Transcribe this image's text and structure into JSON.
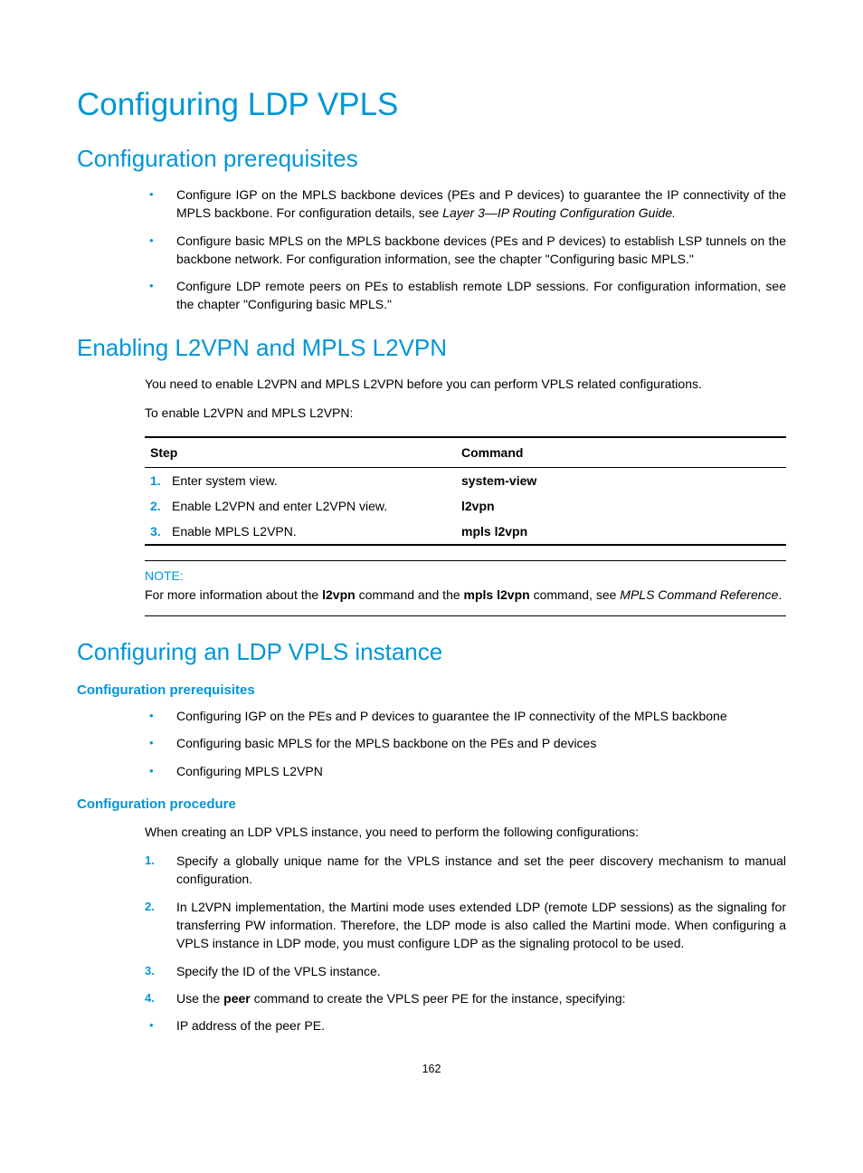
{
  "h1": "Configuring LDP VPLS",
  "sec1": {
    "title": "Configuration prerequisites",
    "bullets": [
      {
        "pre": "Configure IGP on the MPLS backbone devices (PEs and P devices) to guarantee the IP connectivity of the MPLS backbone. For configuration details, see ",
        "italic": "Layer 3—IP Routing Configuration Guide."
      },
      {
        "pre": "Configure basic MPLS on the MPLS backbone devices (PEs and P devices) to establish LSP tunnels on the backbone network. For configuration information, see the chapter \"Configuring basic MPLS.\""
      },
      {
        "pre": "Configure LDP remote peers on PEs to establish remote LDP sessions. For configuration information, see the chapter \"Configuring basic MPLS.\""
      }
    ]
  },
  "sec2": {
    "title": "Enabling L2VPN and MPLS L2VPN",
    "p1": "You need to enable L2VPN and MPLS L2VPN before you can perform VPLS related configurations.",
    "p2": "To enable L2VPN and MPLS L2VPN:",
    "table": {
      "headers": [
        "Step",
        "Command"
      ],
      "rows": [
        {
          "num": "1.",
          "step": "Enter system view.",
          "cmd": "system-view"
        },
        {
          "num": "2.",
          "step": "Enable L2VPN and enter L2VPN view.",
          "cmd": "l2vpn"
        },
        {
          "num": "3.",
          "step": "Enable MPLS L2VPN.",
          "cmd": "mpls l2vpn"
        }
      ]
    },
    "note": {
      "label": "NOTE:",
      "text_pre": "For more information about the ",
      "cmd1": "l2vpn",
      "mid1": " command and the ",
      "cmd2": "mpls l2vpn",
      "mid2": " command, see ",
      "ref": "MPLS Command Reference",
      "post": "."
    }
  },
  "sec3": {
    "title": "Configuring an LDP VPLS instance",
    "sub1": {
      "title": "Configuration prerequisites",
      "bullets": [
        "Configuring IGP on the PEs and P devices to guarantee the IP connectivity of the MPLS backbone",
        "Configuring basic MPLS for the MPLS backbone on the PEs and P devices",
        "Configuring MPLS L2VPN"
      ]
    },
    "sub2": {
      "title": "Configuration procedure",
      "intro": "When creating an LDP VPLS instance, you need to perform the following configurations:",
      "items": [
        "Specify a globally unique name for the VPLS instance and set the peer discovery mechanism to manual configuration.",
        "In L2VPN implementation, the Martini mode uses extended LDP (remote LDP sessions) as the signaling for transferring PW information. Therefore, the LDP mode is also called the Martini mode. When configuring a VPLS instance in LDP mode, you must configure LDP as the signaling protocol to be used.",
        "Specify the ID of the VPLS instance."
      ],
      "item4_pre": "Use the ",
      "item4_bold": "peer",
      "item4_post": " command to create the VPLS peer PE for the instance, specifying:",
      "bullet": "IP address of the peer PE."
    }
  },
  "page_number": "162"
}
